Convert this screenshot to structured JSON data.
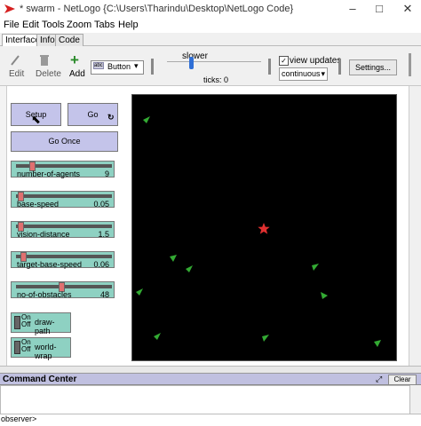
{
  "window": {
    "title": "* swarm - NetLogo {C:\\Users\\Tharindu\\Desktop\\NetLogo Code}",
    "controls": [
      "–",
      "□",
      "✕"
    ]
  },
  "menu": [
    "File",
    "Edit",
    "Tools",
    "Zoom",
    "Tabs",
    "Help"
  ],
  "tabs": [
    "Interface",
    "Info",
    "Code"
  ],
  "toolbar": {
    "edit": "Edit",
    "delete": "Delete",
    "add": "Add",
    "widget_type": "Button",
    "speed_label": "slower",
    "ticks": "ticks: 0",
    "view_updates": "view updates",
    "update_mode": "continuous",
    "settings": "Settings..."
  },
  "buttons": {
    "setup": "Setup",
    "go": "Go",
    "go_once": "Go Once"
  },
  "sliders": [
    {
      "label": "number-of-agents",
      "value": "9",
      "fraction": 0.15
    },
    {
      "label": "base-speed",
      "value": "0.05",
      "fraction": 0.02
    },
    {
      "label": "vision-distance",
      "value": "1.5",
      "fraction": 0.02
    },
    {
      "label": "target-base-speed",
      "value": "0.06",
      "fraction": 0.05
    },
    {
      "label": "no-of-obstacles",
      "value": "48",
      "fraction": 0.48
    }
  ],
  "switches": [
    {
      "label": "draw-path",
      "on": "On",
      "off": "Off"
    },
    {
      "label": "world-wrap",
      "on": "On",
      "off": "Off"
    }
  ],
  "command_center": {
    "title": "Command Center",
    "clear": "Clear",
    "prompt": "observer>"
  },
  "colors": {
    "button": "#c4c4ea",
    "slider": "#8ed1c2",
    "world": "#000000",
    "agent": "#33aa33",
    "target": "#e03030"
  }
}
